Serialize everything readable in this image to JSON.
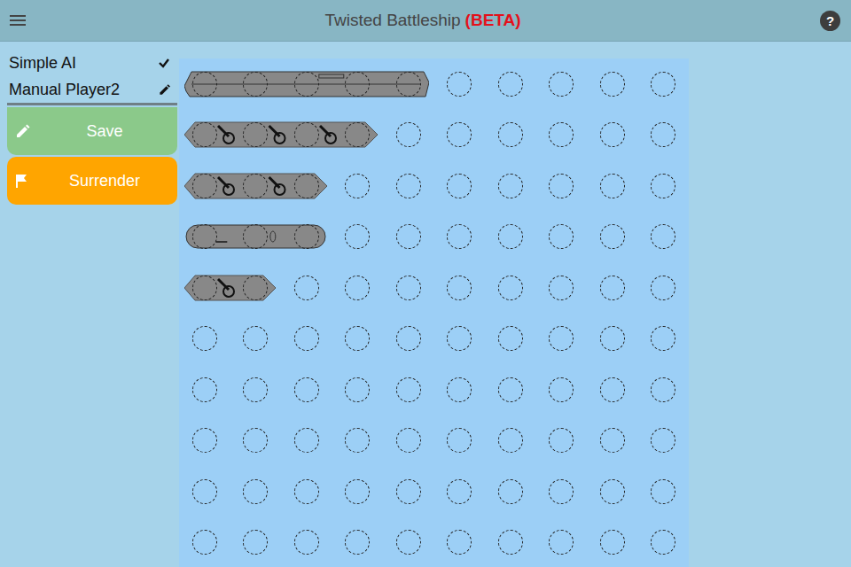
{
  "header": {
    "title": "Twisted Battleship",
    "badge": "(BETA)",
    "help": "?"
  },
  "players": [
    {
      "name": "Simple AI",
      "kind": "ready"
    },
    {
      "name": "Manual Player2",
      "kind": "editing"
    }
  ],
  "actions": [
    {
      "label": "Save",
      "kind": "save"
    },
    {
      "label": "Surrender",
      "kind": "surrender"
    }
  ],
  "board": {
    "rows": 10,
    "columns": 10,
    "ships": [
      {
        "kind": "carrier",
        "row": 0,
        "column": 0,
        "length": 5
      },
      {
        "kind": "battleship",
        "row": 1,
        "column": 0,
        "length": 4
      },
      {
        "kind": "cruiser",
        "row": 2,
        "column": 0,
        "length": 3
      },
      {
        "kind": "submarine",
        "row": 3,
        "column": 0,
        "length": 3
      },
      {
        "kind": "destroyer",
        "row": 4,
        "column": 0,
        "length": 2
      }
    ]
  }
}
